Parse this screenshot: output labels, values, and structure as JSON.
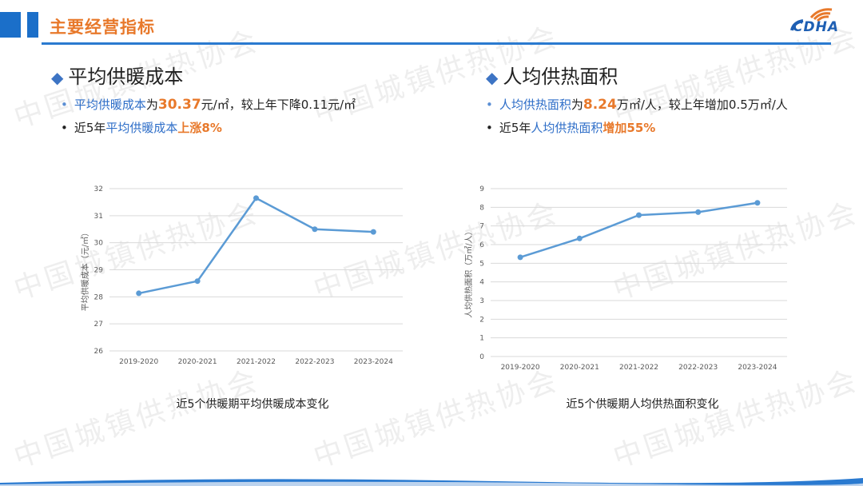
{
  "page": {
    "title": "主要经营指标",
    "logo_text": "CDHA",
    "watermark": "中国城镇供热协会"
  },
  "left_section": {
    "heading": "平均供暖成本",
    "bullet1": {
      "label": "平均供暖成本",
      "connector": "为",
      "value": "30.37",
      "rest": "元/㎡，较上年下降0.11元/㎡"
    },
    "bullet2": {
      "prefix": "近5年",
      "label": "平均供暖成本",
      "highlight": "上涨8%"
    },
    "caption": "近5个供暖期平均供暖成本变化"
  },
  "right_section": {
    "heading": "人均供热面积",
    "bullet1": {
      "label": "人均供热面积",
      "connector": "为",
      "value": "8.24",
      "rest": "万㎡/人，较上年增加0.5万㎡/人"
    },
    "bullet2": {
      "prefix": "近5年",
      "label": "人均供热面积",
      "highlight": "增加55%"
    },
    "caption": "近5个供暖期人均供热面积变化"
  },
  "chart_data": [
    {
      "type": "line",
      "categories": [
        "2019-2020",
        "2020-2021",
        "2021-2022",
        "2022-2023",
        "2023-2024"
      ],
      "series": [
        {
          "values": [
            28.13,
            28.58,
            31.65,
            30.5,
            30.4
          ]
        }
      ],
      "ylabel": "平均供暖成本（元/㎡）",
      "ylim": [
        26,
        32
      ],
      "yticks": [
        26,
        27,
        28,
        29,
        30,
        31,
        32
      ],
      "grid": true,
      "color": "#5b9bd5"
    },
    {
      "type": "line",
      "categories": [
        "2019-2020",
        "2020-2021",
        "2021-2022",
        "2022-2023",
        "2023-2024"
      ],
      "series": [
        {
          "values": [
            5.32,
            6.33,
            7.58,
            7.74,
            8.24
          ]
        }
      ],
      "ylabel": "人均供热面积（万㎡/人）",
      "ylim": [
        0,
        9
      ],
      "yticks": [
        0,
        1,
        2,
        3,
        4,
        5,
        6,
        7,
        8,
        9
      ],
      "grid": true,
      "color": "#5b9bd5"
    }
  ]
}
